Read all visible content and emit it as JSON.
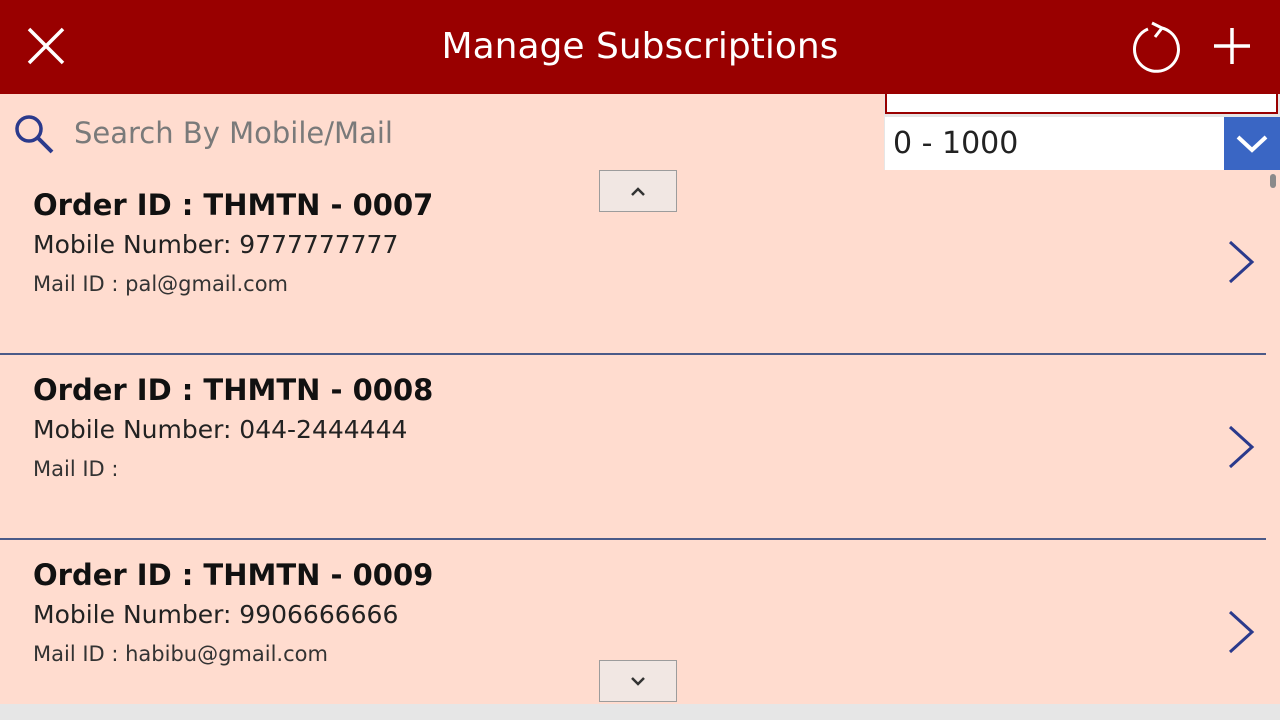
{
  "header": {
    "title": "Manage Subscriptions",
    "background_color": "#990000",
    "close_icon": "close-icon",
    "refresh_icon": "refresh-icon",
    "add_icon": "add-icon"
  },
  "search": {
    "placeholder": "Search By Mobile/Mail",
    "value": "",
    "icon": "search-icon"
  },
  "range_filter": {
    "selected": "0 - 1000",
    "accent_color": "#3a66c4"
  },
  "orders": [
    {
      "order_id": "Order ID : THMTN - 0007",
      "mobile": "Mobile Number: 9777777777",
      "mail": "Mail ID : pal@gmail.com"
    },
    {
      "order_id": "Order ID : THMTN - 0008",
      "mobile": "Mobile Number: 044-2444444",
      "mail": "Mail ID :"
    },
    {
      "order_id": "Order ID : THMTN - 0009",
      "mobile": "Mobile Number: 9906666666",
      "mail": "Mail ID : habibu@gmail.com"
    }
  ],
  "gallery": {
    "background_color": "#ffdccf",
    "scroll_up_icon": "chevron-up-icon",
    "scroll_down_icon": "chevron-down-icon",
    "row_icon": "chevron-right-icon"
  }
}
